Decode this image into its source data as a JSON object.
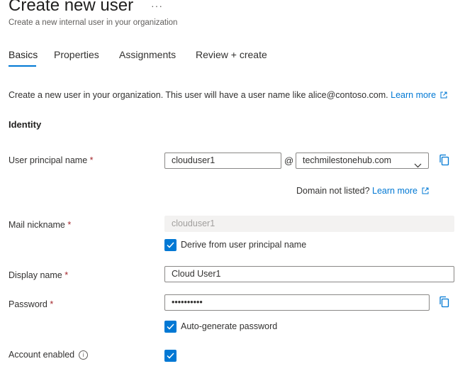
{
  "header": {
    "title": "Create new user",
    "more_label": "···",
    "subtitle": "Create a new internal user in your organization"
  },
  "tabs": [
    {
      "label": "Basics",
      "active": true
    },
    {
      "label": "Properties",
      "active": false
    },
    {
      "label": "Assignments",
      "active": false
    },
    {
      "label": "Review + create",
      "active": false
    }
  ],
  "intro": {
    "text": "Create a new user in your organization. This user will have a user name like alice@contoso.com.",
    "learn_more": "Learn more"
  },
  "identity": {
    "heading": "Identity",
    "upn": {
      "label": "User principal name",
      "required": "*",
      "value": "clouduser1",
      "at": "@",
      "domain": "techmilestonehub.com"
    },
    "domain_note": {
      "text": "Domain not listed?",
      "link": "Learn more"
    },
    "mail_nickname": {
      "label": "Mail nickname",
      "required": "*",
      "value": "clouduser1",
      "derive_label": "Derive from user principal name",
      "derive_checked": true
    },
    "display_name": {
      "label": "Display name",
      "required": "*",
      "value": "Cloud User1"
    },
    "password": {
      "label": "Password",
      "required": "*",
      "value": "••••••••••",
      "auto_label": "Auto-generate password",
      "auto_checked": true
    },
    "account_enabled": {
      "label": "Account enabled",
      "info_icon": "info-icon",
      "checked": true
    }
  },
  "colors": {
    "accent": "#0078d4",
    "required": "#a4262c",
    "text": "#323130",
    "muted": "#605e5c"
  }
}
